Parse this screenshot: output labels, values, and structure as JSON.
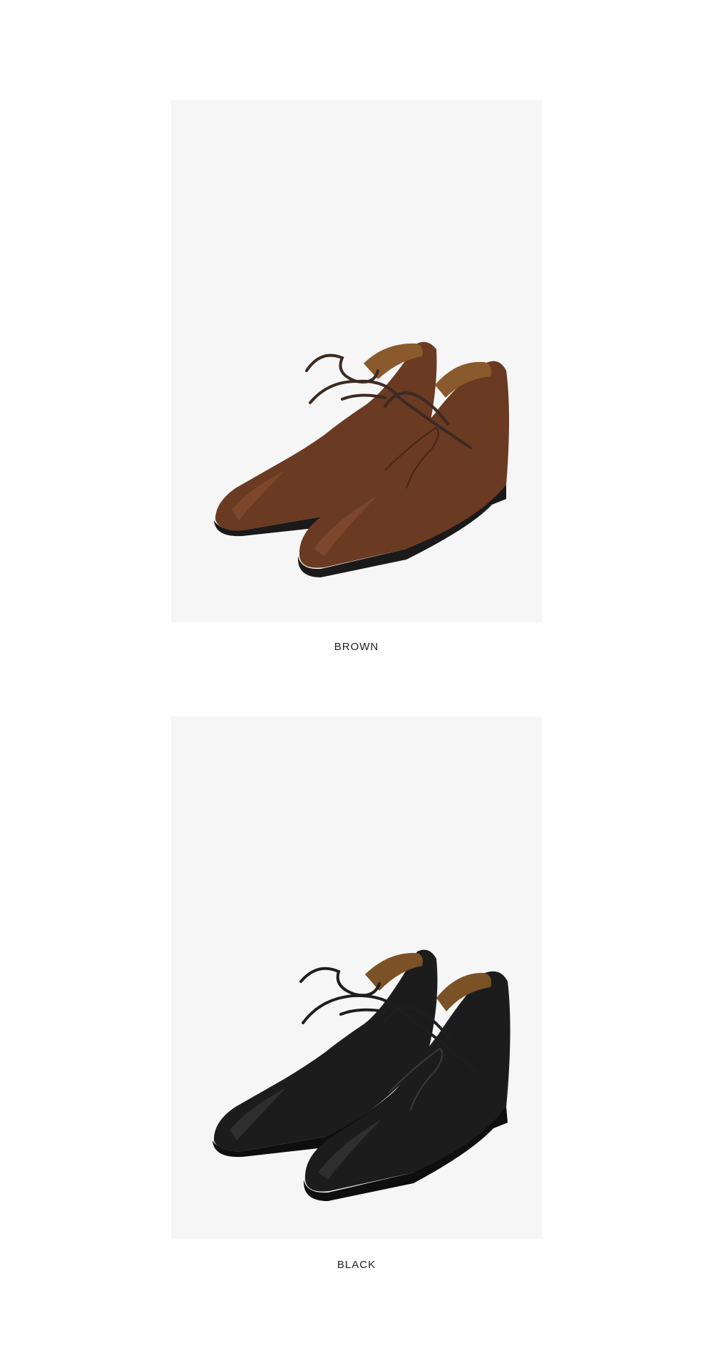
{
  "products": [
    {
      "color_name": "BROWN",
      "shoe_color": "#6a3a22",
      "shoe_highlight": "#8a5236",
      "lining_color": "#8a5a2c",
      "lace_color": "#3b2a22",
      "sole_color": "#1a1a1a"
    },
    {
      "color_name": "BLACK",
      "shoe_color": "#1c1c1c",
      "shoe_highlight": "#3a3a3a",
      "lining_color": "#7a5226",
      "lace_color": "#1e1e1e",
      "sole_color": "#0e0e0e"
    }
  ]
}
